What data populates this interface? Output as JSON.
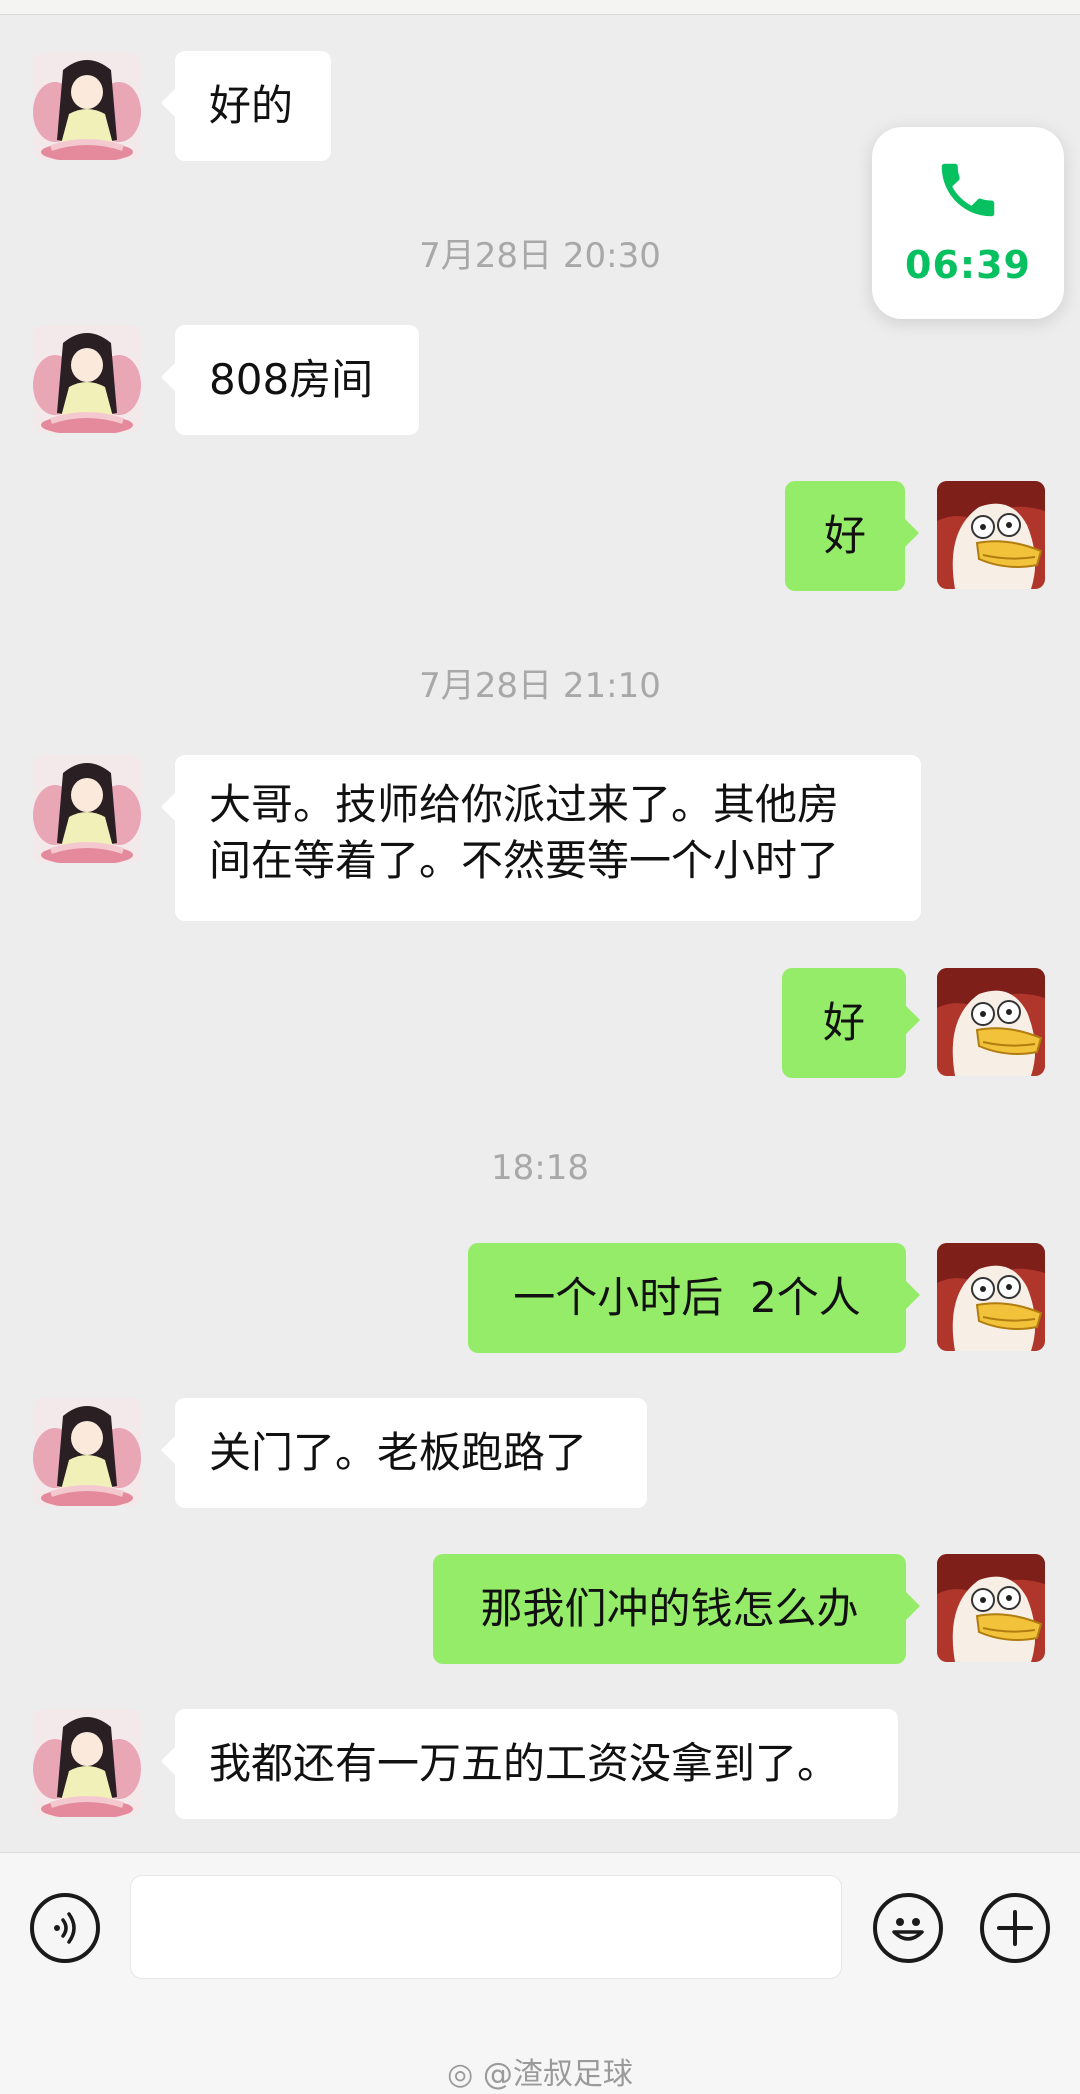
{
  "call": {
    "duration": "06:39",
    "icon": "phone-icon",
    "color": "#07c160"
  },
  "timestamps": [
    "7月28日 20:30",
    "7月28日 21:10",
    "18:18"
  ],
  "messages": [
    {
      "side": "in",
      "text": "好的"
    },
    {
      "side": "in",
      "text": "808房间"
    },
    {
      "side": "out",
      "text": "好"
    },
    {
      "side": "in",
      "lines": [
        "大哥。技师给你派过来了。其他房",
        "间在等着了。不然要等一个小时了"
      ]
    },
    {
      "side": "out",
      "text": "好"
    },
    {
      "side": "out",
      "text": "一个小时后  2个人"
    },
    {
      "side": "in",
      "text": "关门了。老板跑路了"
    },
    {
      "side": "out",
      "text": "那我们冲的钱怎么办"
    },
    {
      "side": "in",
      "text": "我都还有一万五的工资没拿到了。"
    }
  ],
  "input_bar": {
    "voice_icon": "voice-icon",
    "emoji_icon": "emoji-icon",
    "plus_icon": "plus-icon",
    "input_value": ""
  },
  "watermark": "@渣叔足球",
  "colors": {
    "background": "#ededed",
    "incoming_bubble": "#ffffff",
    "outgoing_bubble": "#95ec69",
    "accent": "#07c160"
  }
}
